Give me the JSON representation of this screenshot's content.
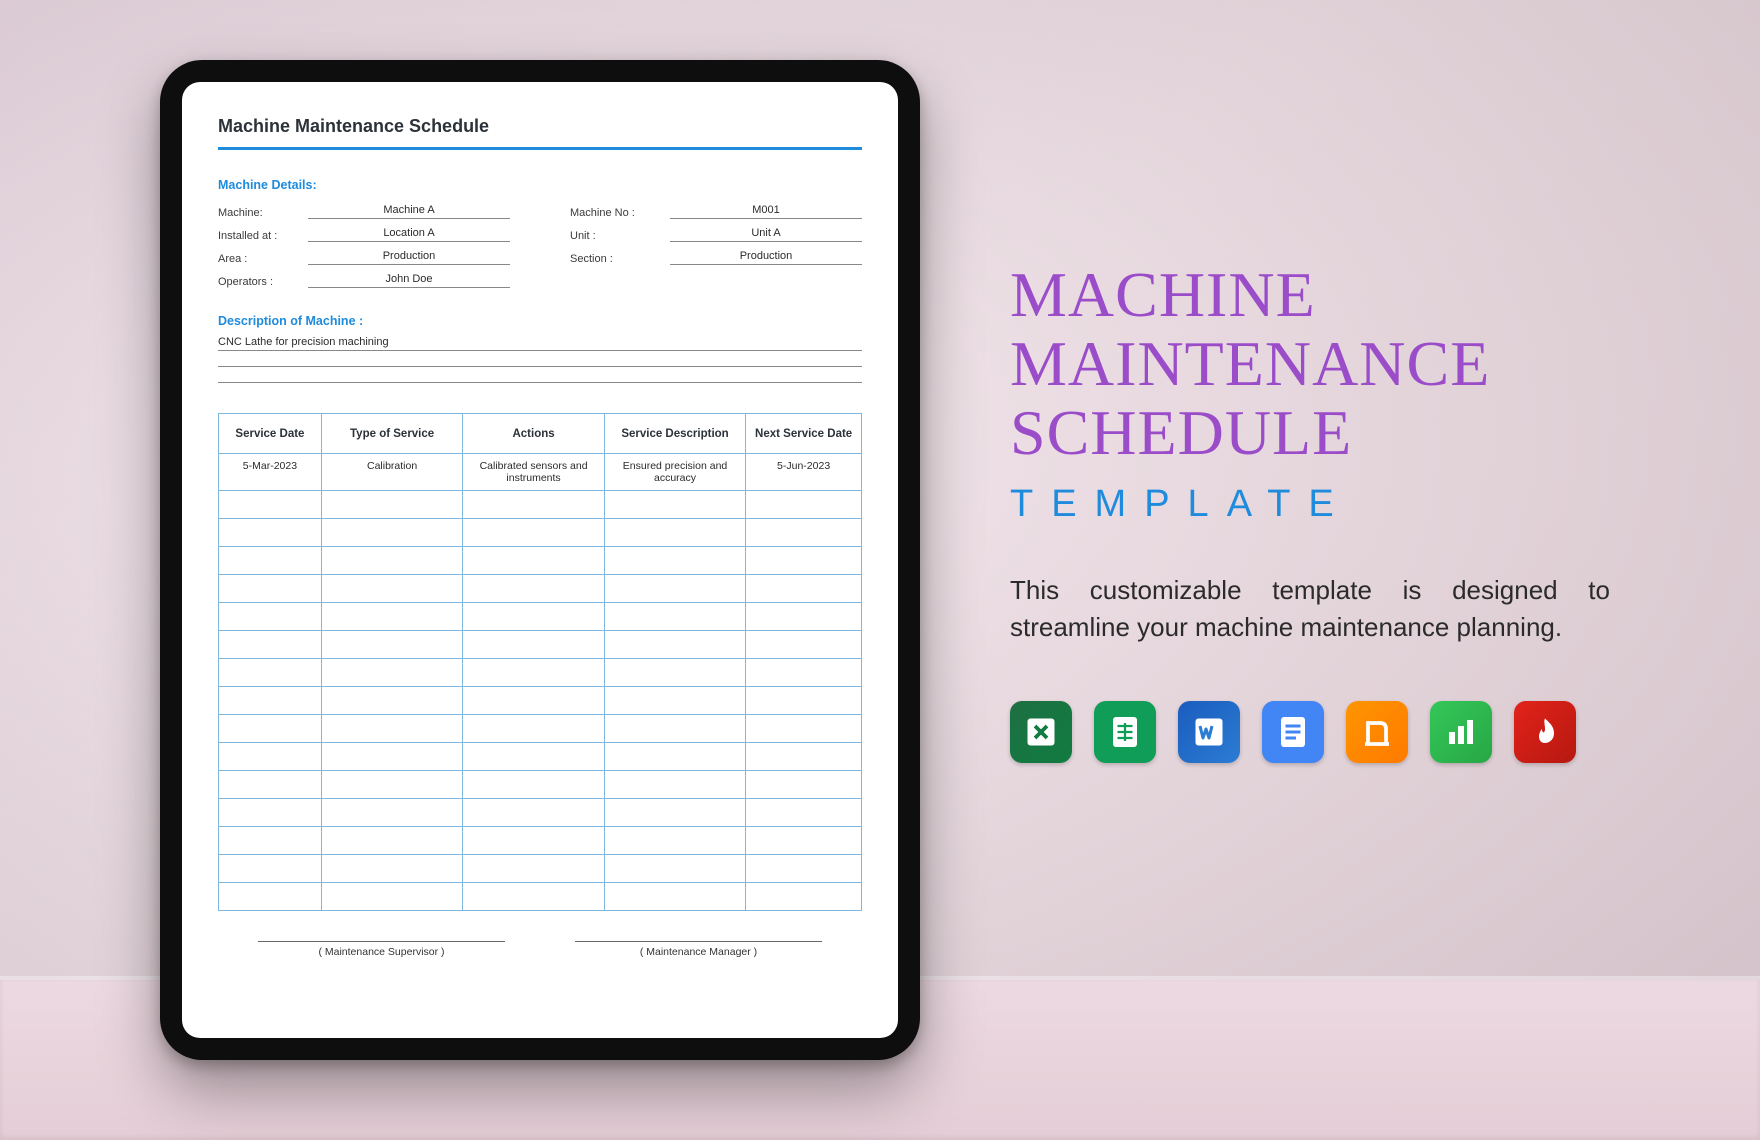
{
  "document": {
    "title": "Machine Maintenance Schedule",
    "sections": {
      "details_label": "Machine Details:",
      "desc_label": "Description of Machine :"
    },
    "details_left": [
      {
        "label": "Machine:",
        "value": "Machine A"
      },
      {
        "label": "Installed at :",
        "value": "Location A"
      },
      {
        "label": "Area :",
        "value": "Production"
      },
      {
        "label": "Operators :",
        "value": "John Doe"
      }
    ],
    "details_right": [
      {
        "label": "Machine No :",
        "value": "M001"
      },
      {
        "label": "Unit :",
        "value": "Unit A"
      },
      {
        "label": "Section :",
        "value": "Production"
      }
    ],
    "description_lines": [
      "CNC Lathe for precision machining",
      "",
      ""
    ],
    "table": {
      "headers": [
        "Service Date",
        "Type of Service",
        "Actions",
        "Service Description",
        "Next Service Date"
      ],
      "rows": [
        {
          "date": "5-Mar-2023",
          "type": "Calibration",
          "actions": "Calibrated sensors and instruments",
          "desc": "Ensured precision and accuracy",
          "next": "5-Jun-2023"
        }
      ],
      "empty_rows": 15
    },
    "signatures": [
      "( Maintenance Supervisor )",
      "( Maintenance Manager )"
    ]
  },
  "marketing": {
    "title_l1": "Machine",
    "title_l2": "Maintenance",
    "title_l3": "Schedule",
    "subtitle": "TEMPLATE",
    "description": "This customizable template is designed to streamline your machine maintenance planning.",
    "apps": [
      "excel",
      "google-sheets",
      "word",
      "google-docs",
      "pages",
      "numbers",
      "pdf"
    ]
  }
}
